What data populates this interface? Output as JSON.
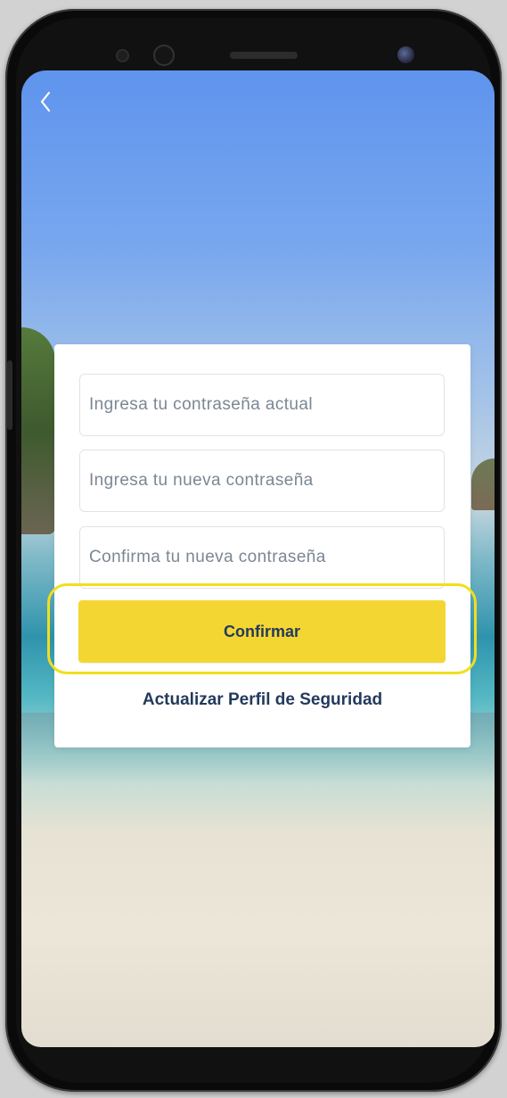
{
  "icons": {
    "back": "chevron-left-icon"
  },
  "form": {
    "current_password": {
      "placeholder": "Ingresa tu contraseña actual",
      "value": ""
    },
    "new_password": {
      "placeholder": "Ingresa tu nueva contraseña",
      "value": ""
    },
    "confirm_password": {
      "placeholder": "Confirma tu nueva contraseña",
      "value": ""
    },
    "confirm_label": "Confirmar",
    "update_profile_label": "Actualizar Perfil de Seguridad"
  },
  "colors": {
    "primary_button": "#f4d632",
    "highlight_ring": "#f1df1c",
    "text_dark_blue": "#233a5c",
    "placeholder_text": "#7b8794"
  }
}
